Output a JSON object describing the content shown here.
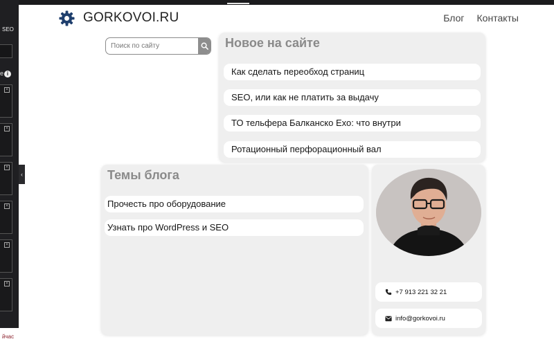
{
  "sidebar": {
    "label": "SEO",
    "info_prefix": "e",
    "info_icon": "i",
    "box_close": "×",
    "footer_text": "йчас",
    "collapse_icon": "‹"
  },
  "header": {
    "site_name": "GORKOVOI.RU",
    "nav": [
      "Блог",
      "Контакты"
    ]
  },
  "search": {
    "placeholder": "Поиск по сайту"
  },
  "new_section": {
    "title": "Новое на сайте",
    "items": [
      "Как сделать переобход страниц",
      "SEO, или как не платить за выдачу",
      "ТО тельфера Балканско Ехо: что внутри",
      "Ротационный перфорационный вал"
    ]
  },
  "topics": {
    "title": "Темы блога",
    "items": [
      "Прочесть про оборудование",
      "Узнать про WordPress и SEO"
    ]
  },
  "profile": {
    "phone": "+7 913 221 32 21",
    "email": "info@gorkovoi.ru"
  },
  "colors": {
    "sidebar_bg": "#1f1f22",
    "panel_bg": "#efefef",
    "heading_gray": "#8a8a8a",
    "logo_blue": "#1f3f6d"
  }
}
